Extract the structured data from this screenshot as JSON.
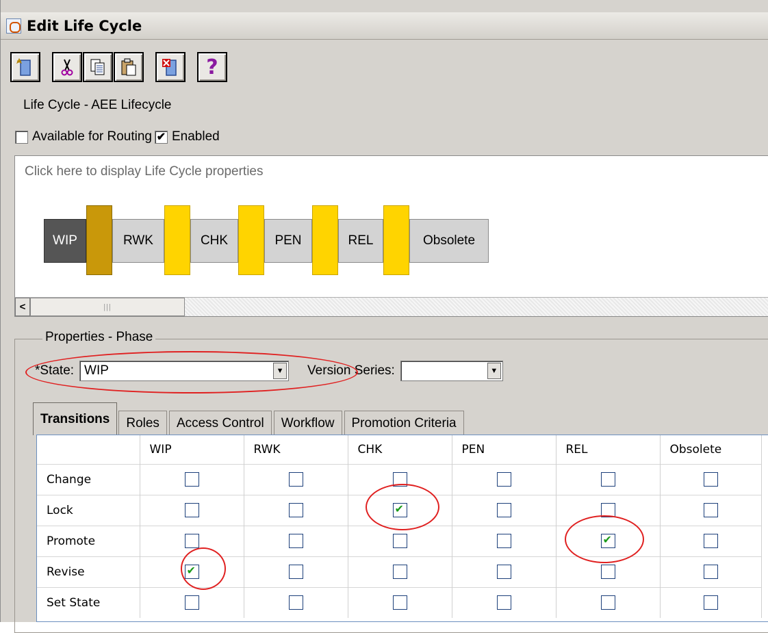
{
  "window": {
    "title": "Edit Life Cycle"
  },
  "lifecycle": {
    "title": "Life Cycle - AEE Lifecycle"
  },
  "options": {
    "available_label": "Available for Routing",
    "available_checked": false,
    "enabled_label": "Enabled",
    "enabled_checked": true
  },
  "diagram": {
    "hint": "Click here to display Life Cycle properties",
    "phases": [
      "WIP",
      "RWK",
      "CHK",
      "PEN",
      "REL",
      "Obsolete"
    ],
    "selected_phase": "WIP"
  },
  "properties": {
    "group_title": "Properties - Phase",
    "state_label": "*State:",
    "state_value": "WIP",
    "version_label": "Version Series:",
    "version_value": ""
  },
  "tabs": [
    "Transitions",
    "Roles",
    "Access Control",
    "Workflow",
    "Promotion Criteria"
  ],
  "active_tab": "Transitions",
  "transitions": {
    "columns": [
      "WIP",
      "RWK",
      "CHK",
      "PEN",
      "REL",
      "Obsolete"
    ],
    "rows": [
      {
        "label": "Change",
        "values": [
          false,
          false,
          false,
          false,
          false,
          false
        ]
      },
      {
        "label": "Lock",
        "values": [
          false,
          false,
          true,
          false,
          false,
          false
        ]
      },
      {
        "label": "Promote",
        "values": [
          false,
          false,
          false,
          false,
          true,
          false
        ]
      },
      {
        "label": "Revise",
        "values": [
          true,
          false,
          false,
          false,
          false,
          false
        ]
      },
      {
        "label": "Set State",
        "values": [
          false,
          false,
          false,
          false,
          false,
          false
        ]
      }
    ]
  },
  "colors": {
    "connector": "#ffd400",
    "connector_selected": "#c9980a",
    "phase_selected": "#555555",
    "annotation": "#e02020",
    "check": "#1a9a1a"
  }
}
